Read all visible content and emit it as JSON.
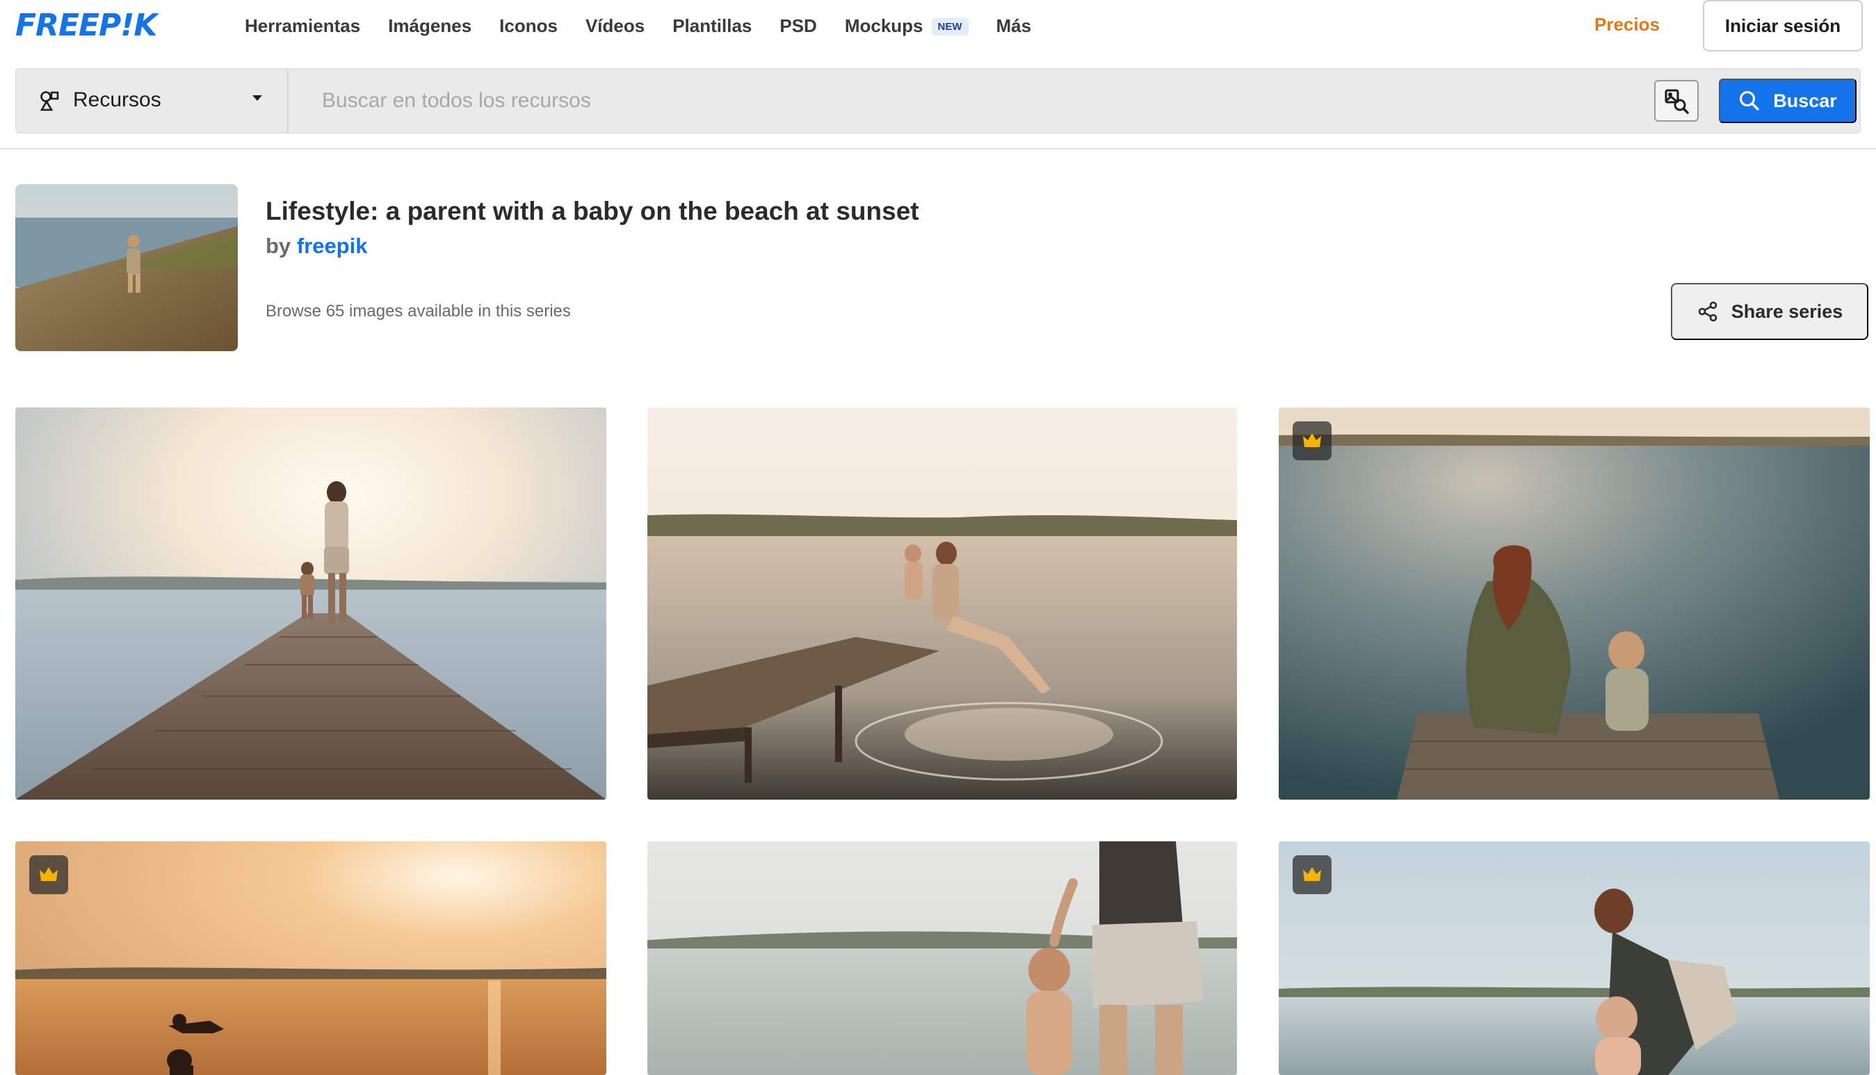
{
  "brand": {
    "logo_text": "FREEP!K",
    "accent_color": "#1273eb"
  },
  "nav": {
    "items": [
      {
        "label": "Herramientas"
      },
      {
        "label": "Imágenes"
      },
      {
        "label": "Iconos"
      },
      {
        "label": "Vídeos"
      },
      {
        "label": "Plantillas"
      },
      {
        "label": "PSD"
      },
      {
        "label": "Mockups",
        "badge": "NEW"
      },
      {
        "label": "Más"
      }
    ],
    "pricing_label": "Precios",
    "pricing_color": "#e07a14",
    "login_label": "Iniciar sesión"
  },
  "search": {
    "resource_type": "Recursos",
    "resource_icon": "shapes-icon",
    "placeholder": "Buscar en todos los recursos",
    "value": "",
    "image_search_icon": "image-search-icon",
    "button_label": "Buscar",
    "button_icon": "search-icon"
  },
  "series": {
    "title": "Lifestyle: a parent with a baby on the beach at sunset",
    "by_prefix": "by",
    "author": "freepik",
    "count_text": "Browse 65 images available in this series",
    "share_label": "Share series",
    "share_icon": "share-icon"
  },
  "gallery": {
    "premium_icon": "crown-icon",
    "premium_color": "#f5b400",
    "items": [
      {
        "premium": false,
        "scene": "pier-walk-sunset"
      },
      {
        "premium": false,
        "scene": "pier-splash-water"
      },
      {
        "premium": true,
        "scene": "pier-sitting-lake"
      },
      {
        "premium": true,
        "scene": "lift-baby-sunset"
      },
      {
        "premium": false,
        "scene": "shore-walk-hands"
      },
      {
        "premium": true,
        "scene": "shore-lift-baby"
      }
    ]
  }
}
